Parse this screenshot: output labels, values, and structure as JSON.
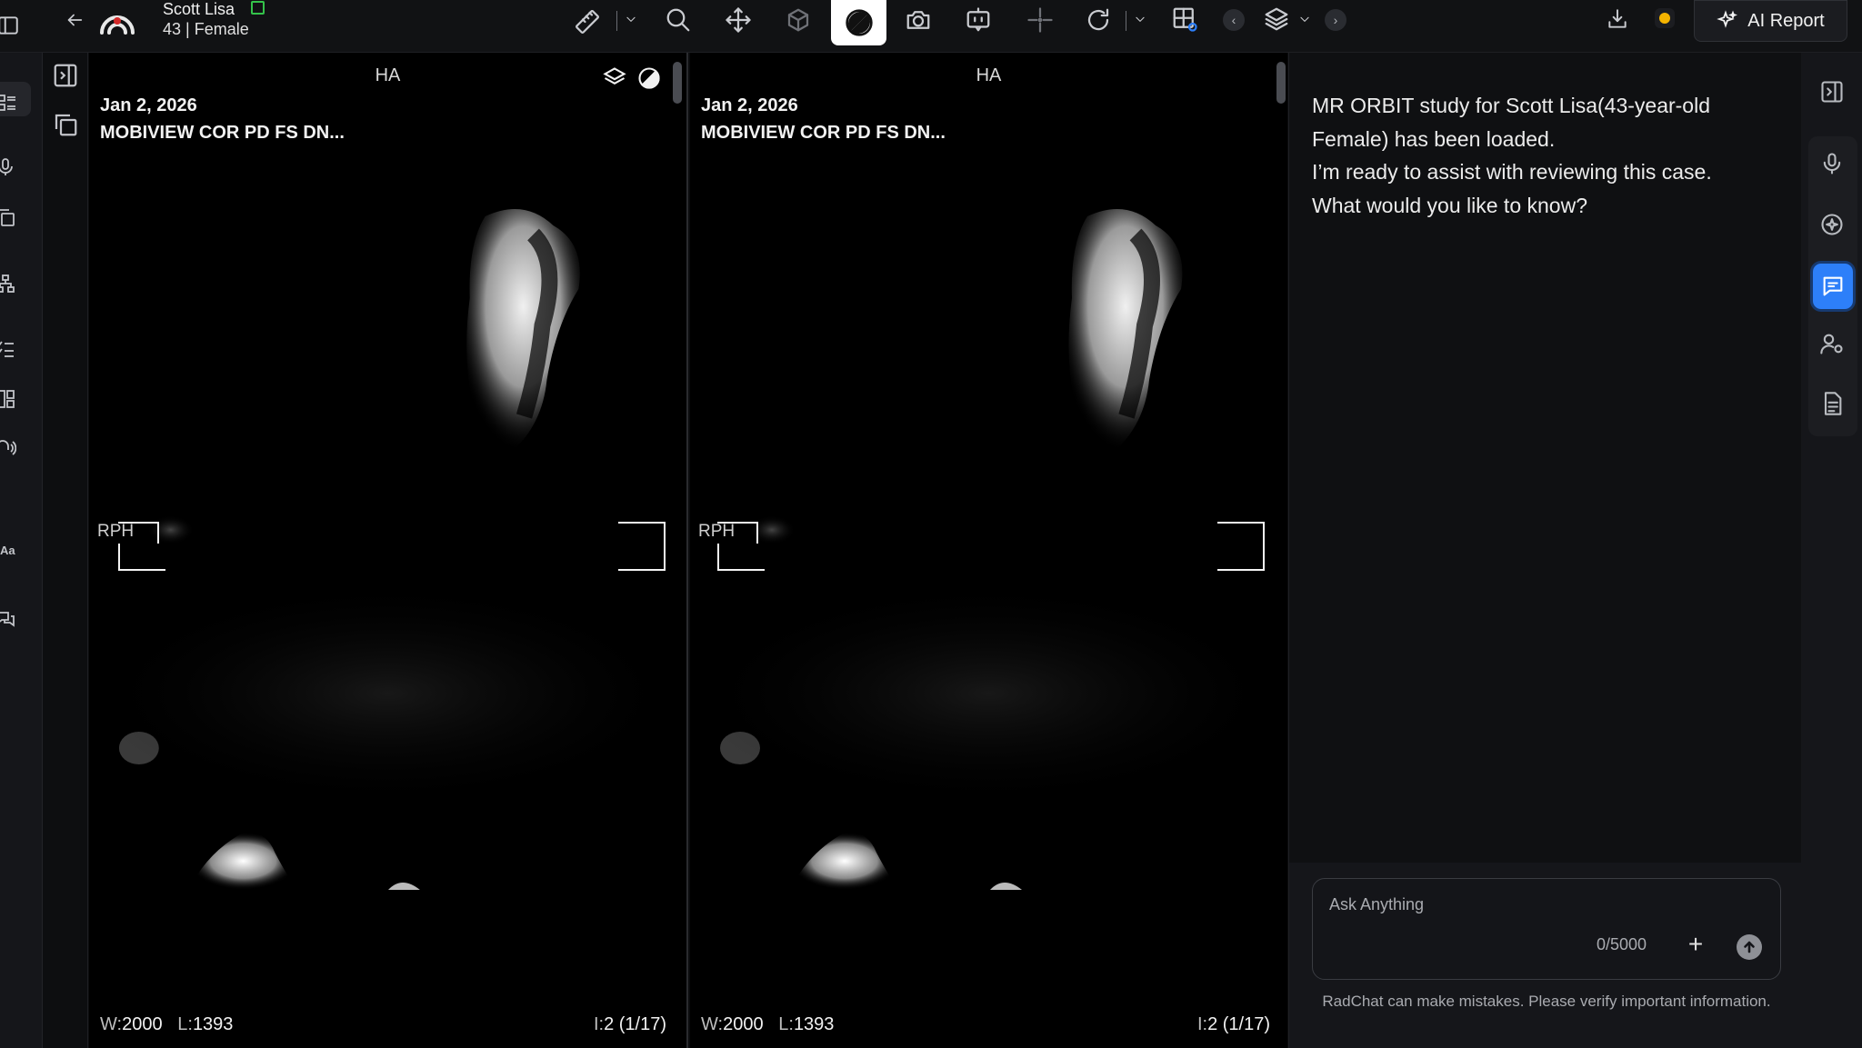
{
  "patient": {
    "name": "Scott Lisa",
    "meta": "43 | Female"
  },
  "toolbar": {
    "ai_report_label": "AI Report"
  },
  "viewports": [
    {
      "orientation_top": "HA",
      "orientation_left": "RPH",
      "date": "Jan 2, 2026",
      "series": "MOBIVIEW COR PD FS DN...",
      "window_label": "W:",
      "window_value": "2000",
      "level_label": "L:",
      "level_value": "1393",
      "image_label": "I:",
      "image_value": "2 (1/17)"
    },
    {
      "orientation_top": "HA",
      "orientation_left": "RPH",
      "date": "Jan 2, 2026",
      "series": "MOBIVIEW COR PD FS DN...",
      "window_label": "W:",
      "window_value": "2000",
      "level_label": "L:",
      "level_value": "1393",
      "image_label": "I:",
      "image_value": "2 (1/17)"
    }
  ],
  "chat": {
    "message_line1": "MR ORBIT study for Scott Lisa(43-year-old Female) has been loaded.",
    "message_line2": "I’m ready to assist with reviewing this case.",
    "message_line3": "What would you like to know?",
    "input_placeholder": "Ask Anything",
    "char_count": "0/5000",
    "disclaimer": "RadChat can make mistakes. Please verify important information."
  },
  "left_rail": {
    "font_label": "Aa"
  },
  "colors": {
    "accent": "#2d7ff9",
    "status_online": "#34c24a",
    "status_dot": "#f5b400"
  }
}
